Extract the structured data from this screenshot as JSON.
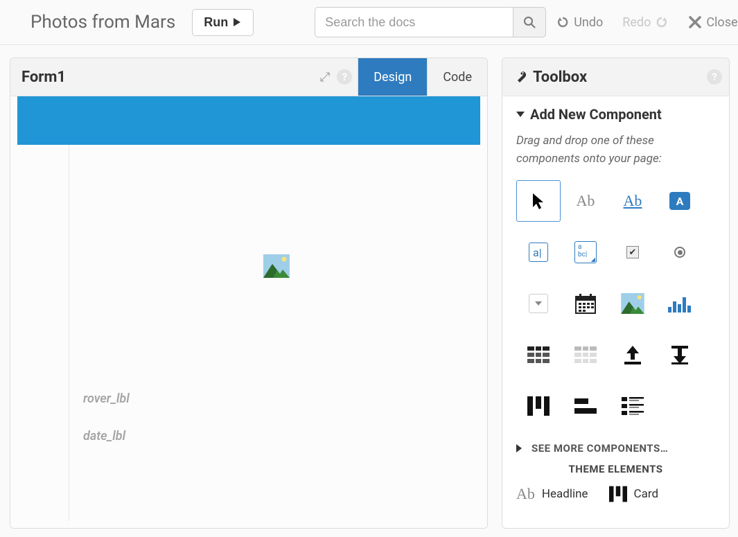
{
  "header": {
    "app_title": "Photos from Mars",
    "run_label": "Run",
    "search_placeholder": "Search the docs",
    "undo_label": "Undo",
    "redo_label": "Redo",
    "close_label": "Close"
  },
  "form_panel": {
    "title": "Form1",
    "tabs": {
      "design": "Design",
      "code": "Code"
    },
    "active_tab": "design",
    "labels": {
      "rover": "rover_lbl",
      "date": "date_lbl"
    }
  },
  "toolbox": {
    "title": "Toolbox",
    "section_add": "Add New Component",
    "hint": "Drag and drop one of these components onto your page:",
    "see_more": "SEE MORE COMPONENTS…",
    "theme_title": "THEME ELEMENTS",
    "theme_items": {
      "headline": "Headline",
      "card": "Card"
    },
    "components": [
      "pointer",
      "label",
      "link",
      "button",
      "textbox",
      "textarea",
      "checkbox",
      "radio",
      "dropdown",
      "datepicker",
      "image",
      "plot",
      "datagriddark",
      "datagridlight",
      "fileupload",
      "filedownload",
      "columnpanel",
      "rowpanel",
      "listpanel"
    ]
  }
}
